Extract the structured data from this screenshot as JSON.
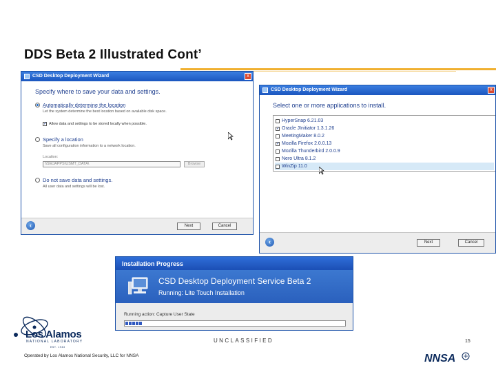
{
  "slide": {
    "title": "DDS Beta 2 Illustrated Cont’",
    "footer_classification": "UNCLASSIFIED",
    "page_number": "15",
    "operated_by": "Operated by Los Alamos National Security, LLC for NNSA"
  },
  "logo": {
    "name": "Los Alamos",
    "subtitle": "NATIONAL LABORATORY",
    "established": "EST. 1943",
    "agency": "NNSA"
  },
  "wizard1": {
    "title": "CSD Desktop Deployment Wizard",
    "close": "x",
    "heading": "Specify where to save your data and settings.",
    "options": [
      {
        "label": "Automatically determine the location",
        "desc": "Let the system determine the best location based on available disk space.",
        "selected": true
      },
      {
        "label": "Specify a location",
        "desc": "Save all configuration information to a network location.",
        "selected": false
      },
      {
        "label": "Do not save data and settings.",
        "desc": "All user data and settings will be lost.",
        "selected": false
      }
    ],
    "local_checkbox_label": "Allow data and settings to be stored locally when possible.",
    "location_label": "Location:",
    "location_value": "\\\\SMJAPPS\\USMT_DATA\\",
    "browse_label": "Browse",
    "next_label": "Next",
    "cancel_label": "Cancel"
  },
  "wizard2": {
    "title": "CSD Desktop Deployment Wizard",
    "close": "x",
    "heading": "Select one or more applications to install.",
    "apps": [
      {
        "name": "HyperSnap 6.21.03",
        "checked": false,
        "selected": false
      },
      {
        "name": "Oracle JInitiator 1.3.1.26",
        "checked": true,
        "selected": false
      },
      {
        "name": "MeetingMaker 8.0.2",
        "checked": false,
        "selected": false
      },
      {
        "name": "Mozilla Firefox 2.0.0.13",
        "checked": true,
        "selected": false
      },
      {
        "name": "Mozilla Thunderbird 2.0.0.9",
        "checked": false,
        "selected": false
      },
      {
        "name": "Nero Ultra 8.1.2",
        "checked": false,
        "selected": false
      },
      {
        "name": "WinZip 11.0",
        "checked": false,
        "selected": true
      }
    ],
    "next_label": "Next",
    "cancel_label": "Cancel"
  },
  "progress": {
    "title": "Installation Progress",
    "line1": "CSD Desktop Deployment Service Beta 2",
    "line2": "Running: Lite Touch Installation",
    "status": "Running action: Capture User State",
    "percent": 0.08
  },
  "colors": {
    "accent_rule": "#f0b030",
    "window_titlebar": "#1b56bf",
    "wizard_text": "#1f3f8f",
    "logo_navy": "#0b2a5c"
  }
}
